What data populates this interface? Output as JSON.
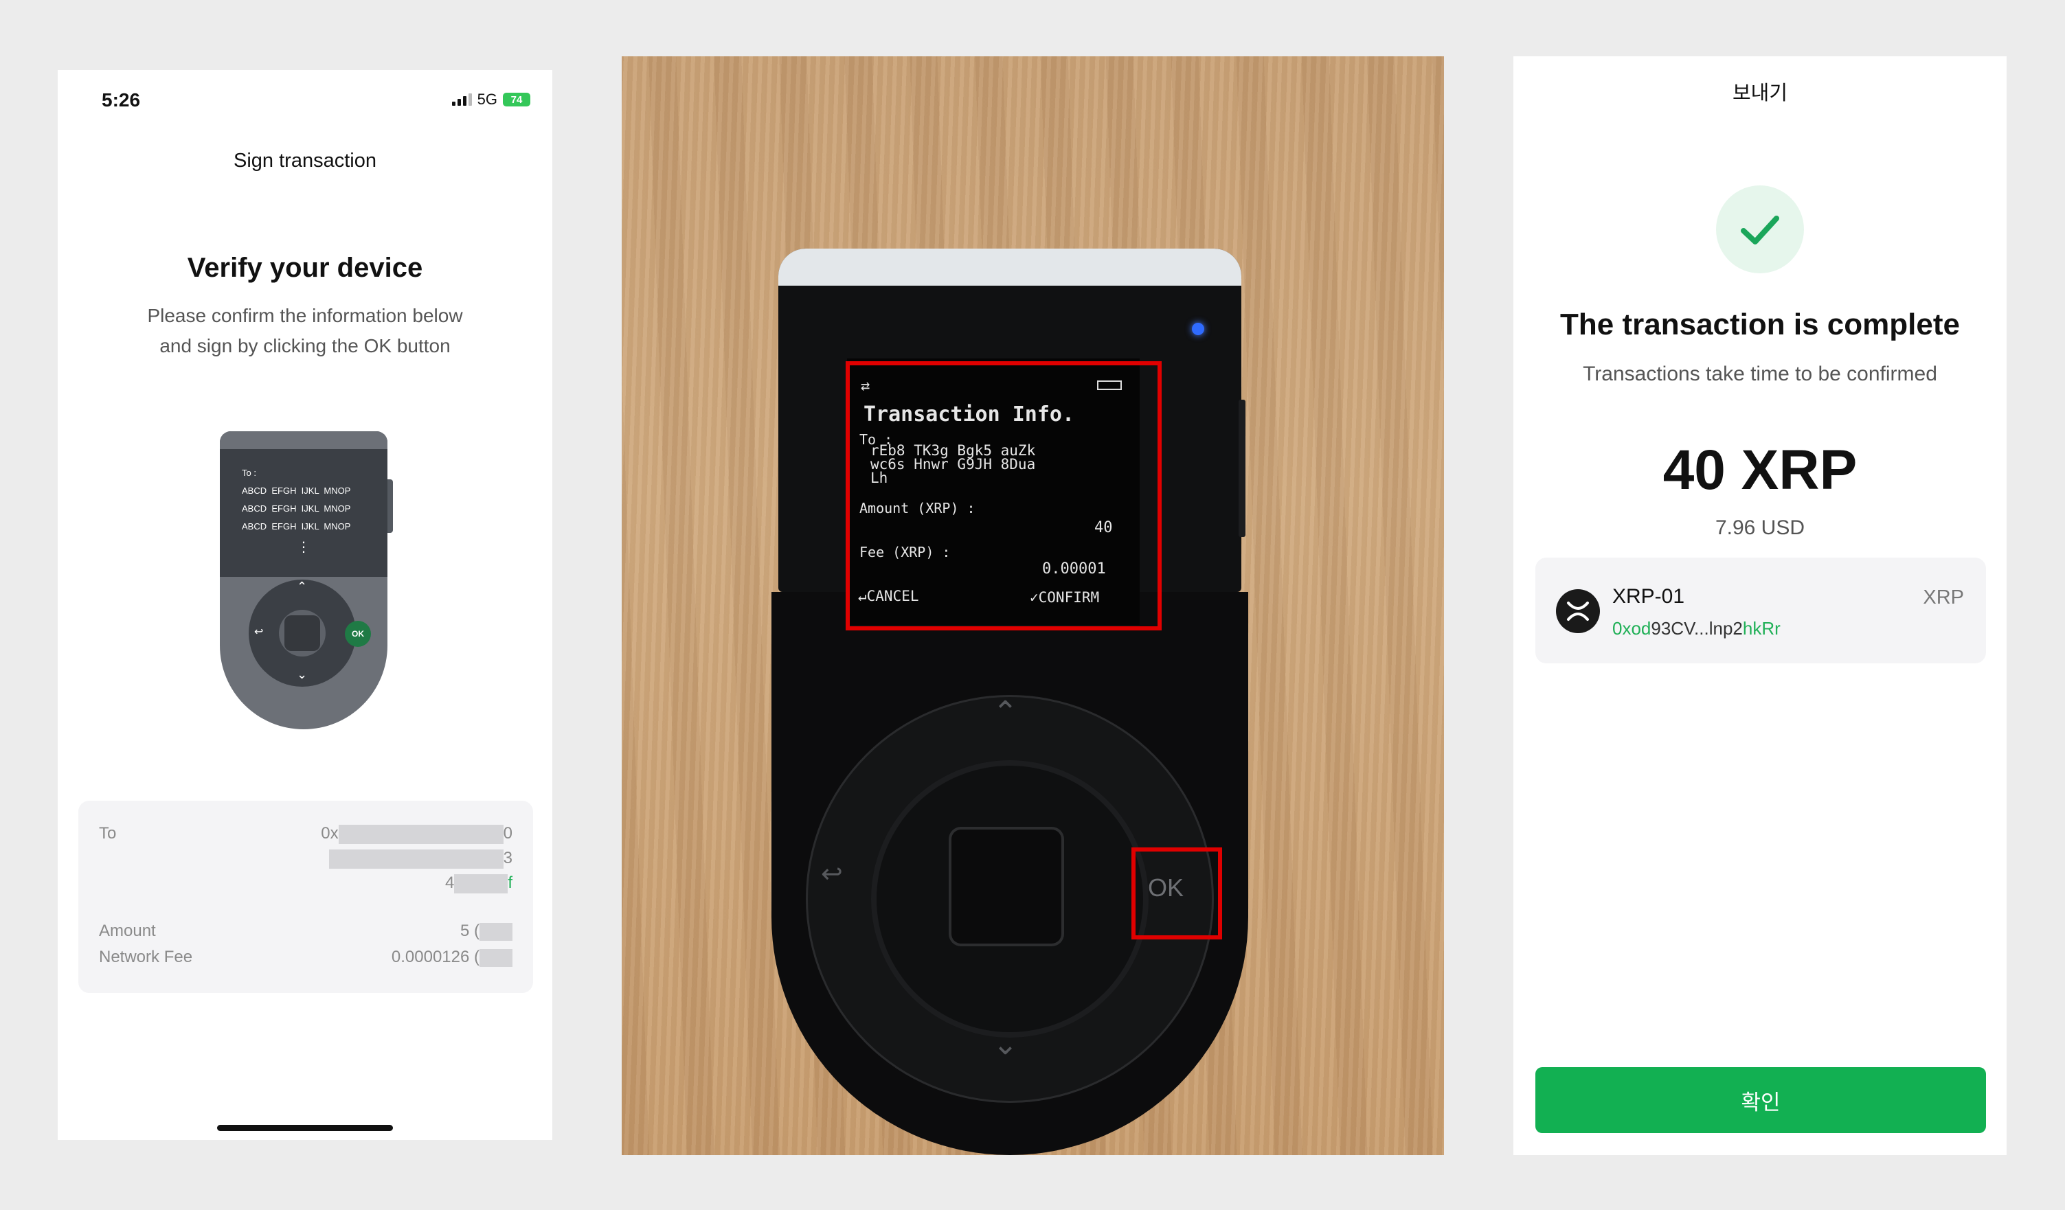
{
  "left_panel": {
    "status_time": "5:26",
    "network": "5G",
    "battery": "74",
    "nav_title": "Sign transaction",
    "heading": "Verify your device",
    "instruction_line1": "Please confirm the information below",
    "instruction_line2": "and sign by clicking the OK button",
    "device_illustration": {
      "to_label": "To :",
      "address_rows": [
        "ABCD  EFGH  IJKL  MNOP",
        "ABCD  EFGH  IJKL  MNOP",
        "ABCD  EFGH  IJKL  MNOP"
      ],
      "ok_label": "OK"
    },
    "details": {
      "to_label": "To",
      "to_line1_prefix": "0x",
      "to_line1_suffix": "0",
      "to_line2_suffix": "3",
      "to_line3_prefix": "4",
      "to_line3_suffix": "f",
      "amount_label": "Amount",
      "amount_value": "5 (",
      "fee_label": "Network Fee",
      "fee_value": "0.0000126 ("
    }
  },
  "center_photo": {
    "lcd": {
      "title": "Transaction Info.",
      "to_label": "To :",
      "address_line1": "rEb8 TK3g Bgk5 auZk",
      "address_line2": "wc6s Hnwr G9JH 8Dua",
      "address_line3": "Lh",
      "amount_label": "Amount (XRP) :",
      "amount_value": "40",
      "fee_label": "Fee (XRP) :",
      "fee_value": "0.00001",
      "cancel_label": "↵CANCEL",
      "confirm_label": "✓CONFIRM"
    },
    "ok_button_label": "OK",
    "highlight_color": "#e00000"
  },
  "right_panel": {
    "title": "보내기",
    "success_heading": "The transaction is complete",
    "success_sub": "Transactions take time to be confirmed",
    "amount": "40 XRP",
    "amount_usd": "7.96 USD",
    "account": {
      "name": "XRP-01",
      "symbol": "XRP",
      "address_prefix": "0xod",
      "address_middle": "93CV...lnp2",
      "address_suffix": "hkRr"
    },
    "confirm_button": "확인",
    "accent_color": "#12b052"
  }
}
